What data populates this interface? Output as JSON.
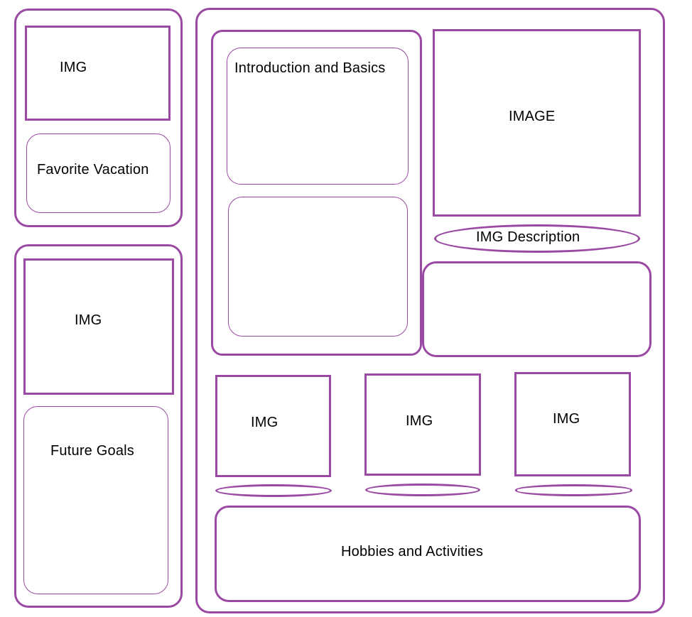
{
  "left_top": {
    "img_label": "IMG",
    "favorite_vacation": "Favorite Vacation"
  },
  "left_bottom": {
    "img_label": "IMG",
    "future_goals": "Future Goals"
  },
  "main": {
    "intro_text": "Introduction and Basics",
    "image_label": "IMAGE",
    "img_description": "IMG Description",
    "gallery": [
      {
        "label": "IMG"
      },
      {
        "label": "IMG"
      },
      {
        "label": "IMG"
      }
    ],
    "hobbies": "Hobbies and Activities"
  }
}
